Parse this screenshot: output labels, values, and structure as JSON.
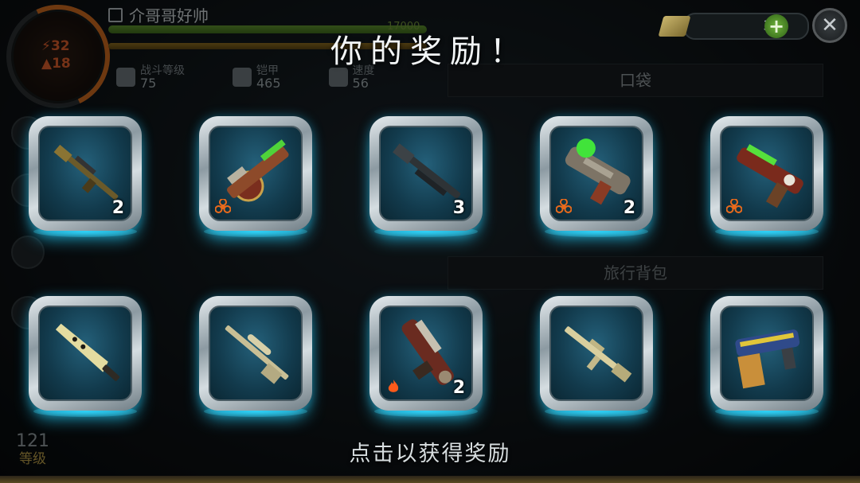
{
  "player": {
    "name": "介哥哥好帅",
    "stat_a": "32",
    "stat_b": "18",
    "xp_text": "17000"
  },
  "title": "你的奖励！",
  "currency": {
    "value": "35",
    "add_label": "+"
  },
  "close_label": "✕",
  "stats": [
    {
      "label": "战斗等级",
      "value": "75",
      "icon": "fist-icon"
    },
    {
      "label": "铠甲",
      "value": "465",
      "icon": "armor-icon"
    },
    {
      "label": "速度",
      "value": "56",
      "icon": "boot-icon"
    }
  ],
  "sections": {
    "pocket": "口袋",
    "backpack": "旅行背包"
  },
  "level": {
    "value": "121",
    "label": "等级"
  },
  "footer": "点击以获得奖励",
  "rewards": [
    {
      "weapon": "sniper-rifle",
      "count": "2",
      "badge": ""
    },
    {
      "weapon": "biohazard-heavy-gun",
      "count": "",
      "badge": "biohazard"
    },
    {
      "weapon": "shotgun",
      "count": "3",
      "badge": ""
    },
    {
      "weapon": "toxic-blaster",
      "count": "2",
      "badge": "biohazard"
    },
    {
      "weapon": "toxic-pistol",
      "count": "",
      "badge": "biohazard"
    },
    {
      "weapon": "machete",
      "count": "",
      "badge": ""
    },
    {
      "weapon": "scoped-rifle",
      "count": "",
      "badge": ""
    },
    {
      "weapon": "flame-launcher",
      "count": "2",
      "badge": "fire"
    },
    {
      "weapon": "assault-rifle",
      "count": "",
      "badge": ""
    },
    {
      "weapon": "drill-gun",
      "count": "",
      "badge": ""
    }
  ],
  "colors": {
    "accent_glow": "#46e6ff",
    "biohazard": "#e86a1c",
    "fire": "#ff5a1a"
  }
}
